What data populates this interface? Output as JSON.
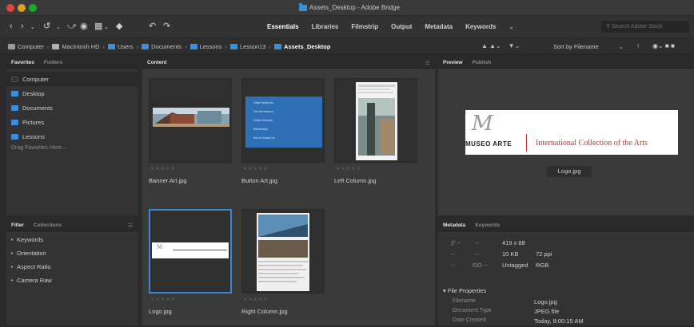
{
  "window": {
    "title": "Assets_Desktop - Adobe Bridge"
  },
  "toolbar": {
    "workspaces": [
      "Essentials",
      "Libraries",
      "Filmstrip",
      "Output",
      "Metadata",
      "Keywords"
    ],
    "active_workspace": "Essentials",
    "search_placeholder": "Search Adobe Stock"
  },
  "path": {
    "crumbs": [
      {
        "label": "Computer",
        "icon": "computer-icon"
      },
      {
        "label": "Macintosh HD",
        "icon": "hard-drive-icon"
      },
      {
        "label": "Users",
        "icon": "folder-icon"
      },
      {
        "label": "Documents",
        "icon": "folder-icon"
      },
      {
        "label": "Lessons",
        "icon": "folder-icon"
      },
      {
        "label": "Lesson13",
        "icon": "folder-icon"
      },
      {
        "label": "Assets_Desktop",
        "icon": "folder-icon"
      }
    ],
    "sort_label": "Sort by Filename"
  },
  "favorites": {
    "tabs": [
      "Favorites",
      "Folders"
    ],
    "items": [
      {
        "label": "Computer",
        "icon": "computer-icon"
      },
      {
        "label": "Desktop",
        "icon": "folder-icon"
      },
      {
        "label": "Documents",
        "icon": "folder-icon"
      },
      {
        "label": "Pictures",
        "icon": "folder-icon"
      },
      {
        "label": "Lessons",
        "icon": "folder-icon"
      }
    ],
    "hint": "Drag Favorites Here..."
  },
  "filter": {
    "tabs": [
      "Filter",
      "Collections"
    ],
    "items": [
      "Keywords",
      "Orientation",
      "Aspect Ratio",
      "Camera Raw"
    ]
  },
  "content": {
    "tab": "Content",
    "files": [
      {
        "name": "Banner Art.jpg"
      },
      {
        "name": "Button Art.jpg"
      },
      {
        "name": "Left Column.jpg"
      },
      {
        "name": "Logo.jpg"
      },
      {
        "name": "Right Column.jpg"
      }
    ],
    "button_art_lines": [
      "Tower Rental Info",
      "Tour the Museum",
      "Exhibit Schedule",
      "Membership",
      "How to Contact Us"
    ]
  },
  "preview": {
    "tabs": [
      "Preview",
      "Publish"
    ],
    "label": "Logo.jpg",
    "logo_left": "MUSEO ARTE",
    "logo_right": "International Collection of the Arts"
  },
  "metadata": {
    "tabs": [
      "Metadata",
      "Keywords"
    ],
    "grid": {
      "f": "f/ --",
      "exposure": "--",
      "dims": "419 x 88",
      "r2a": "--",
      "r2b": "--",
      "size": "10 KB",
      "ppi": "72 ppi",
      "r3a": "--",
      "iso": "ISO --",
      "profile": "Untagged",
      "mode": "RGB"
    },
    "section": "File Properties",
    "rows": [
      {
        "label": "Filename",
        "value": "Logo.jpg"
      },
      {
        "label": "Document Type",
        "value": "JPEG file"
      },
      {
        "label": "Date Created",
        "value": "Today, 8:00:15 AM"
      }
    ]
  },
  "colors": {
    "accent": "#3b87d6",
    "folder": "#3b8fd8",
    "logo_red": "#c0392b"
  }
}
